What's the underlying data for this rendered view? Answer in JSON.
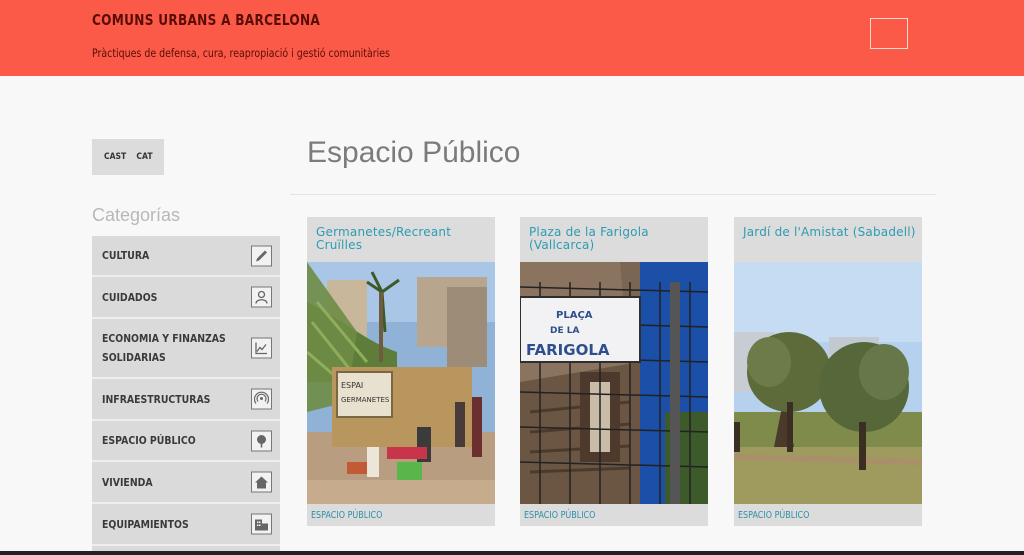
{
  "header": {
    "title": "COMUNS URBANS A BARCELONA",
    "tagline": "Pràctiques de defensa, cura, reapropiació i gestió comunitàries"
  },
  "language": {
    "cast": "CAST",
    "cat": "CAT"
  },
  "sidebar": {
    "heading": "Categorías",
    "items": [
      {
        "label": "CULTURA",
        "icon": "pencil-icon"
      },
      {
        "label": "CUIDADOS",
        "icon": "people-icon"
      },
      {
        "label": "ECONOMIA Y FINANZAS SOLIDARIAS",
        "icon": "chart-icon"
      },
      {
        "label": "INFRAESTRUCTURAS",
        "icon": "antenna-icon"
      },
      {
        "label": "ESPACIO PÚBLICO",
        "icon": "tree-icon"
      },
      {
        "label": "VIVIENDA",
        "icon": "house-icon"
      },
      {
        "label": "EQUIPAMIENTOS",
        "icon": "building-icon"
      }
    ]
  },
  "main": {
    "title": "Espacio Público",
    "cards": [
      {
        "title": "Germanetes/Recreant Cruïlles",
        "category": "ESPACIO PÚBLICO",
        "sign": "ESPAI GERMANETES"
      },
      {
        "title": "Plaza de la Farigola (Vallcarca)",
        "category": "ESPACIO PÚBLICO",
        "sign": "PLAÇA DE LA FARIGOLA"
      },
      {
        "title": "Jardí de l'Amistat (Sabadell)",
        "category": "ESPACIO PÚBLICO"
      }
    ]
  },
  "colors": {
    "header": "#fb5a48",
    "link": "#2e9bb2"
  }
}
